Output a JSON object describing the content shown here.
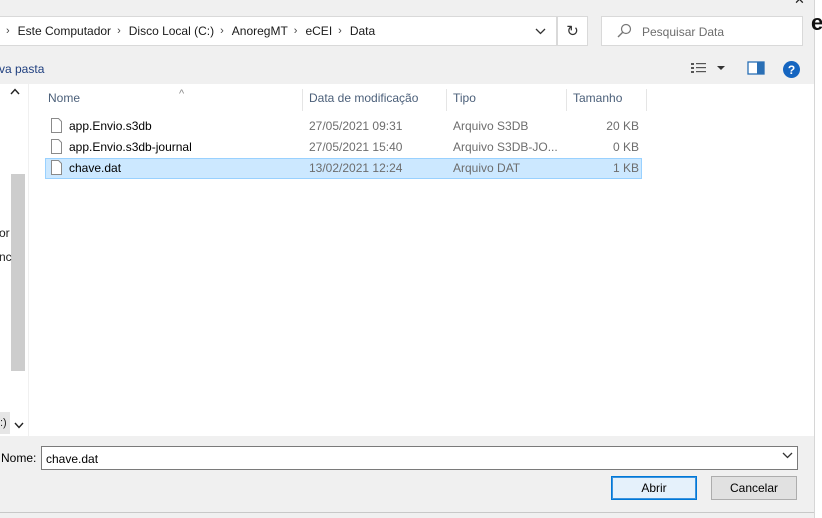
{
  "address_bar": {
    "breadcrumbs": [
      "Este Computador",
      "Disco Local (C:)",
      "AnoregMT",
      "eCEI",
      "Data"
    ]
  },
  "search": {
    "placeholder": "Pesquisar Data"
  },
  "toolbar": {
    "new_folder_label": "va pasta"
  },
  "nav_pane": {
    "text_1": "or",
    "text_2": "nc",
    "text_3": ":)"
  },
  "file_list": {
    "columns": {
      "name": "Nome",
      "date": "Data de modificação",
      "type": "Tipo",
      "size": "Tamanho"
    },
    "files": [
      {
        "name": "app.Envio.s3db",
        "date": "27/05/2021 09:31",
        "type": "Arquivo S3DB",
        "size": "20 KB",
        "selected": false
      },
      {
        "name": "app.Envio.s3db-journal",
        "date": "27/05/2021 15:40",
        "type": "Arquivo S3DB-JO...",
        "size": "0 KB",
        "selected": false
      },
      {
        "name": "chave.dat",
        "date": "13/02/2021 12:24",
        "type": "Arquivo DAT",
        "size": "1 KB",
        "selected": true
      }
    ]
  },
  "filename": {
    "label": "Nome:",
    "value": "chave.dat"
  },
  "buttons": {
    "open": "Abrir",
    "cancel": "Cancelar"
  },
  "background_window": {
    "fragment": "e"
  },
  "colors": {
    "selection": "#cce8ff",
    "accent": "#0078d7",
    "help": "#1565c0"
  }
}
